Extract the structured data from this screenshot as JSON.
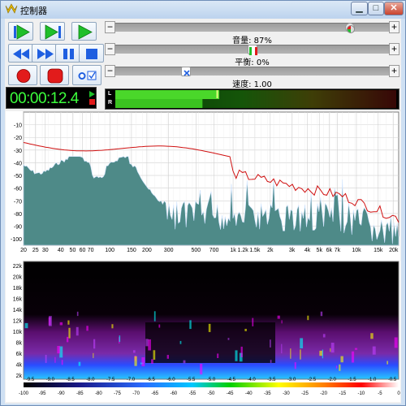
{
  "window": {
    "title": "控制器",
    "min_glyph": "▁",
    "max_glyph": "□",
    "close_glyph": "✕"
  },
  "sliders": {
    "volume": {
      "label": "音量: 87%",
      "value": 0.87
    },
    "balance": {
      "label": "平衡: 0%",
      "value": 0.0
    },
    "speed": {
      "label": "速度: 1.00",
      "value": 1.0
    },
    "minus": "−",
    "plus": "+"
  },
  "time": "00:00:12.4",
  "meter": {
    "left_label": "L",
    "right_label": "R",
    "left_level": 0.37,
    "right_level": 0.31,
    "peak": 0.36
  },
  "colors": {
    "play": "#1fbf2a",
    "accent_blue": "#1f5fe0",
    "record": "#e21b1b",
    "spectrum_fill": "#4e8a88",
    "peak_line": "#d01010"
  },
  "spectrum": {
    "y_ticks": [
      "-10",
      "-20",
      "-30",
      "-40",
      "-50",
      "-60",
      "-70",
      "-80",
      "-90",
      "-100"
    ],
    "x_ticks": [
      "20",
      "25",
      "30",
      "40",
      "50",
      "60",
      "70",
      "100",
      "150",
      "200",
      "300",
      "500",
      "700",
      "1k",
      "1.2k",
      "1.5k",
      "2k",
      "3k",
      "4k",
      "5k",
      "6k",
      "7k",
      "10k",
      "15k",
      "20k"
    ]
  },
  "spectrogram": {
    "y_ticks": [
      "22k",
      "20k",
      "18k",
      "16k",
      "14k",
      "12k",
      "10k",
      "8k",
      "6k",
      "4k",
      "2k"
    ],
    "scale_top": [
      "-9.5",
      "-9.0",
      "-8.5",
      "-8.0",
      "-7.5",
      "-7.0",
      "-6.5",
      "-6.0",
      "-5.5",
      "-5.0",
      "-4.5",
      "-4.0",
      "-3.5",
      "-3.0",
      "-2.5",
      "-2.0",
      "-1.5",
      "-1.0",
      "-0.5"
    ],
    "scale_bottom": [
      "-100",
      "-95",
      "-90",
      "-85",
      "-80",
      "-75",
      "-70",
      "-65",
      "-60",
      "-55",
      "-50",
      "-45",
      "-40",
      "-35",
      "-30",
      "-25",
      "-20",
      "-15",
      "-10",
      "-5",
      "0"
    ]
  }
}
